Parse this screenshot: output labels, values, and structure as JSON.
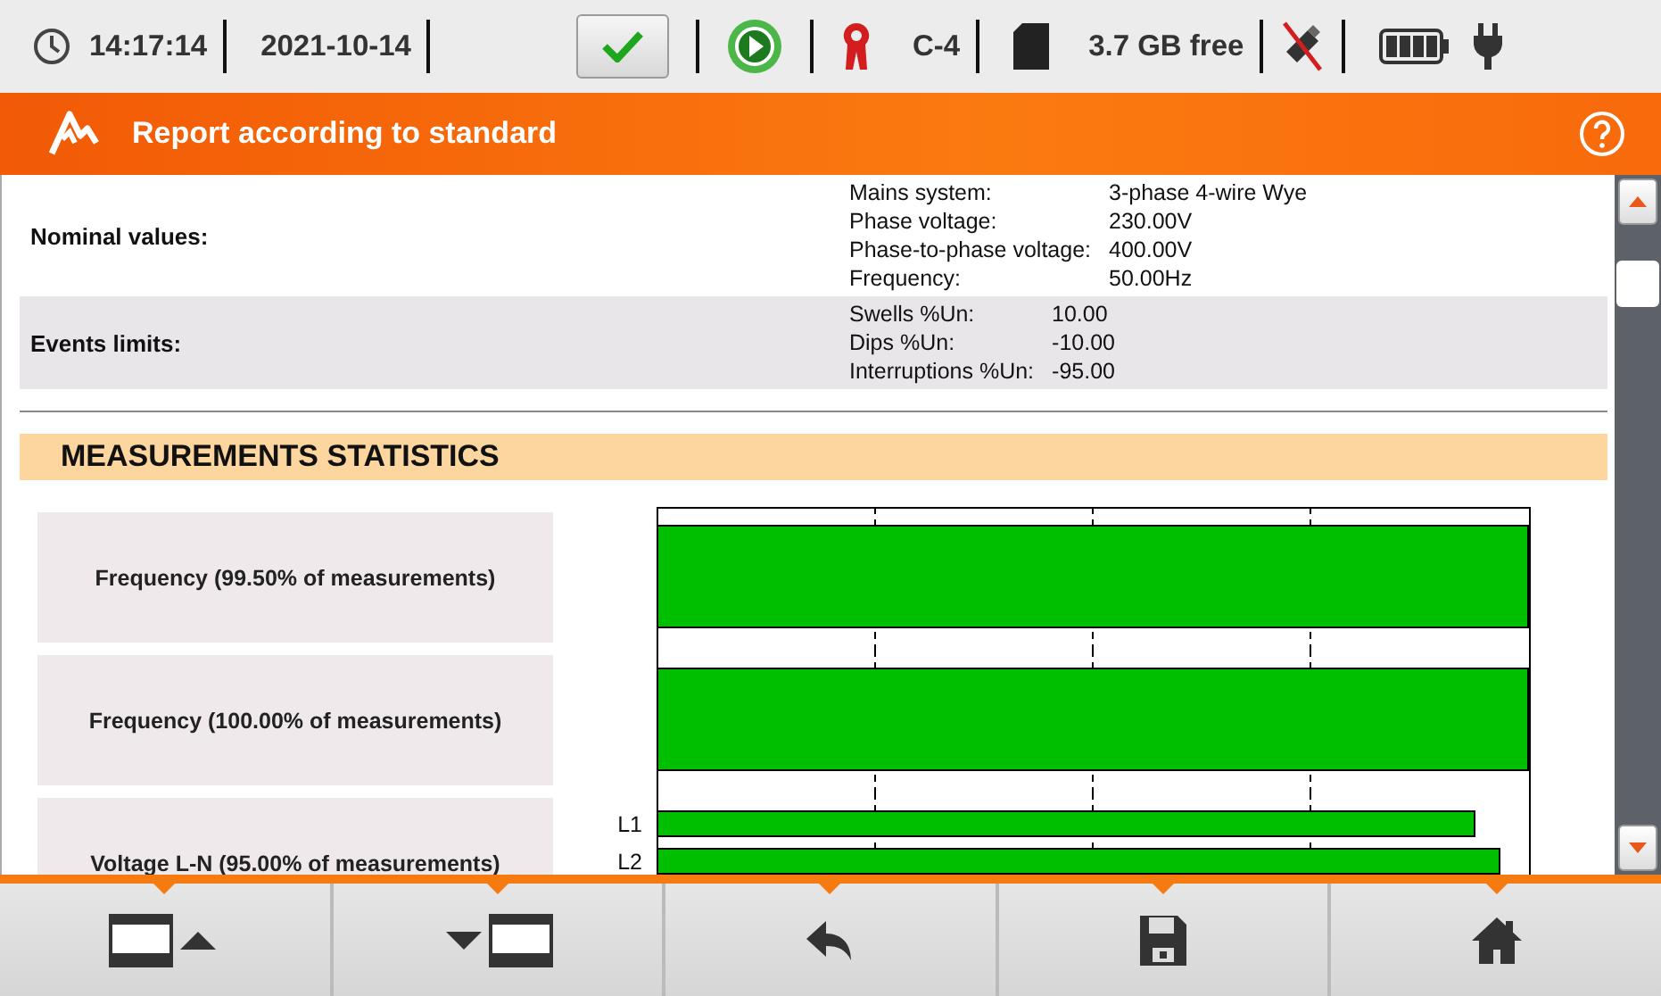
{
  "status_bar": {
    "time": "14:17:14",
    "date": "2021-10-14",
    "clamp": "C-4",
    "storage": "3.7 GB free"
  },
  "header": {
    "title": "Report according to standard"
  },
  "settings": [
    {
      "label": "Nominal values:",
      "items": [
        {
          "name": "Mains system:",
          "value": "3-phase 4-wire Wye"
        },
        {
          "name": "Phase voltage:",
          "value": "230.00V"
        },
        {
          "name": "Phase-to-phase voltage:",
          "value": "400.00V"
        },
        {
          "name": "Frequency:",
          "value": "50.00Hz"
        }
      ]
    },
    {
      "label": "Events limits:",
      "items": [
        {
          "name": "Swells %Un:",
          "value": "10.00"
        },
        {
          "name": "Dips %Un:",
          "value": "-10.00"
        },
        {
          "name": "Interruptions %Un:",
          "value": "-95.00"
        }
      ]
    }
  ],
  "section_title": "MEASUREMENTS STATISTICS",
  "statistics": [
    {
      "label": "Frequency (99.50% of measurements)",
      "kind": "single"
    },
    {
      "label": "Frequency (100.00% of measurements)",
      "kind": "single"
    },
    {
      "label": "Voltage L-N (95.00% of measurements)",
      "kind": "phases",
      "phases": [
        "L1",
        "L2"
      ]
    }
  ],
  "toolbar": [
    {
      "kind": "page-up"
    },
    {
      "kind": "page-down"
    },
    {
      "kind": "back"
    },
    {
      "kind": "save"
    },
    {
      "kind": "home"
    }
  ]
}
